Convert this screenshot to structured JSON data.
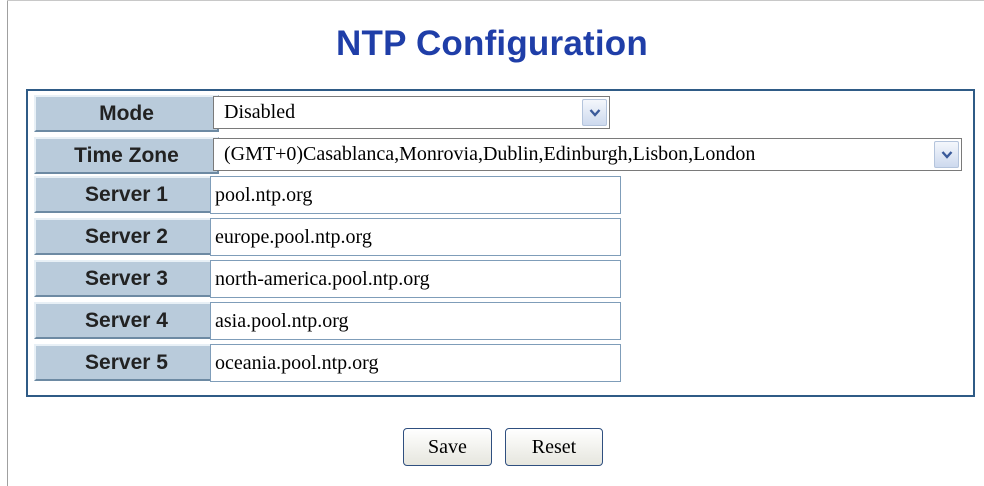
{
  "page": {
    "title": "NTP Configuration"
  },
  "form": {
    "labels": {
      "mode": "Mode",
      "time_zone": "Time Zone",
      "server1": "Server 1",
      "server2": "Server 2",
      "server3": "Server 3",
      "server4": "Server 4",
      "server5": "Server 5"
    },
    "mode_selected": "Disabled",
    "time_zone_selected": "(GMT+0)Casablanca,Monrovia,Dublin,Edinburgh,Lisbon,London",
    "servers": [
      "pool.ntp.org",
      "europe.pool.ntp.org",
      "north-america.pool.ntp.org",
      "asia.pool.ntp.org",
      "oceania.pool.ntp.org"
    ]
  },
  "buttons": {
    "save": "Save",
    "reset": "Reset"
  },
  "icons": {
    "dropdown": "chevron-down-icon"
  },
  "colors": {
    "title": "#1f3ea8",
    "label_bg": "#b9cbdb",
    "table_border": "#2f5b86"
  }
}
